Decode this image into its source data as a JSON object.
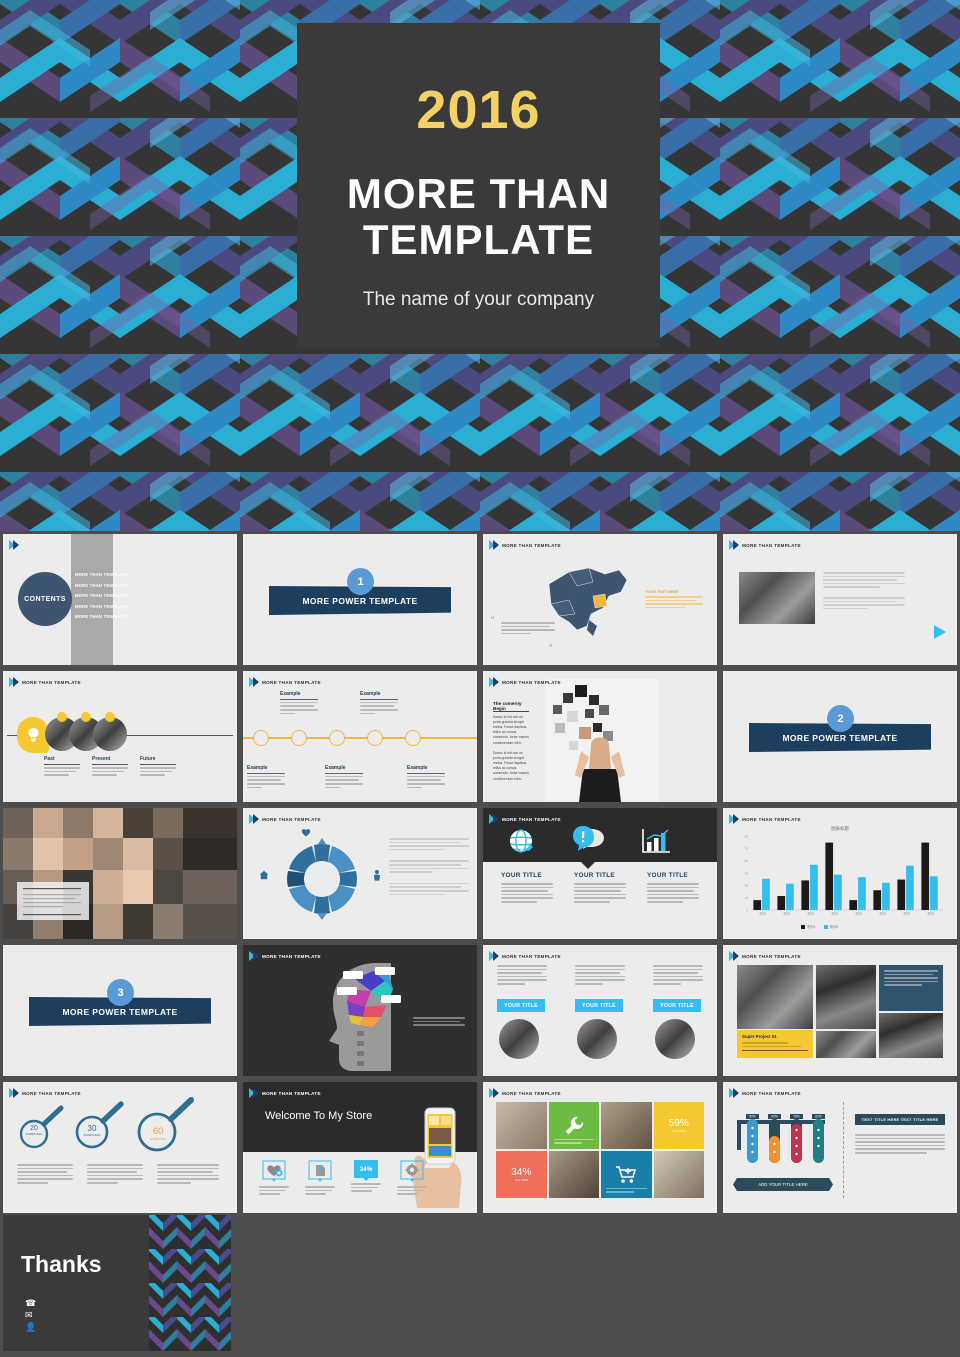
{
  "hero": {
    "year": "2016",
    "title_line1": "MORE THAN",
    "title_line2": "TEMPLATE",
    "subtitle": "The name of your company",
    "bg_color": "#353535",
    "accent_color": "#f5d163"
  },
  "common": {
    "header_label": "MORE THAN TEMPLATE",
    "chevron_light": "#3fb6ea",
    "chevron_dark": "#1f3f63",
    "navy": "#1d3f5f",
    "light_blue": "#5b9bd5",
    "cyan": "#35bdf2",
    "yellow": "#f5c731"
  },
  "slides": [
    {
      "id": "contents",
      "kind": "contents",
      "circle_label": "CONTENTS",
      "items": [
        "MORE THAN TEMPLATE",
        "MORE THAN TEMPLATE",
        "MORE THAN TEMPLATE",
        "MORE THAN TEMPLATE",
        "MORE THAN TEMPLATE"
      ]
    },
    {
      "id": "section-1",
      "kind": "section",
      "number": "1",
      "banner": "MORE POWER TEMPLATE"
    },
    {
      "id": "china-map",
      "kind": "map",
      "header": "MORE THAN TEMPLATE",
      "callout_title": "YOUR TEXT HERE",
      "quote_open": "“",
      "quote_close": "”"
    },
    {
      "id": "laptop-text",
      "kind": "image-text",
      "header": "MORE THAN TEMPLATE"
    },
    {
      "id": "past-present-future",
      "kind": "timeline-ppf",
      "header": "MORE THAN TEMPLATE",
      "steps": [
        "Past",
        "Present",
        "Future"
      ]
    },
    {
      "id": "example-timeline",
      "kind": "timeline-example",
      "header": "MORE THAN TEMPLATE",
      "labels": [
        "Example",
        "Example",
        "Example",
        "Example",
        "Example"
      ]
    },
    {
      "id": "company-begin",
      "kind": "text-photo",
      "header": "MORE THAN TEMPLATE",
      "title": "The comerny Begin",
      "body": "Donec id elit non mi porta gravida at eget metus. Fusce dapibus, tellus ac cursus commodo, tortor mauris condimentum nibh."
    },
    {
      "id": "section-2",
      "kind": "section",
      "number": "2",
      "banner": "MORE POWER TEMPLATE"
    },
    {
      "id": "team-photo",
      "kind": "full-photo"
    },
    {
      "id": "donut-diagram",
      "kind": "donut",
      "header": "MORE THAN TEMPLATE"
    },
    {
      "id": "three-icon-cards",
      "kind": "icon-cards",
      "header": "MORE THAN TEMPLATE",
      "cards": [
        {
          "title": "YOUR TITLE",
          "icon": "globe-icon"
        },
        {
          "title": "YOUR TITLE",
          "icon": "speech-bubble-icon"
        },
        {
          "title": "YOUR TITLE",
          "icon": "bar-chart-icon"
        }
      ],
      "body": "Add your text here and write down your ideas here add your text here and write down your ideas here add your text thank you"
    },
    {
      "id": "bar-chart",
      "kind": "chart",
      "header": "MORE THAN TEMPLATE"
    },
    {
      "id": "section-3",
      "kind": "section",
      "number": "3",
      "banner": "MORE POWER TEMPLATE"
    },
    {
      "id": "brain-head",
      "kind": "brain",
      "header": "MORE THAN TEMPLATE",
      "tags": [
        "TEXT",
        "TEXT",
        "TEXT",
        "TEXT"
      ],
      "body": "Add your text here and write down your ideas here add your text here"
    },
    {
      "id": "three-title-photos",
      "kind": "title-photos",
      "header": "MORE THAN TEMPLATE",
      "titles": [
        "YOUR TITLE",
        "YOUR TITLE",
        "YOUR TITLE"
      ]
    },
    {
      "id": "architecture-mosaic",
      "kind": "mosaic-arch",
      "header": "MORE THAN TEMPLATE",
      "project_label": "Super Project 01"
    },
    {
      "id": "magnifier-stats",
      "kind": "magnifiers",
      "header": "MORE THAN TEMPLATE",
      "stats": [
        {
          "value": "20",
          "label": "SOMETHING",
          "color": "#2f6f8f"
        },
        {
          "value": "30",
          "label": "SOMETHING",
          "color": "#2f6f8f"
        },
        {
          "value": "60",
          "label": "SOMETHING",
          "color": "#e8a33d"
        }
      ]
    },
    {
      "id": "welcome-store",
      "kind": "store",
      "header": "MORE THAN TEMPLATE",
      "title": "Welcome To My Store",
      "tiles": [
        {
          "icon": "heart-icon",
          "label": ""
        },
        {
          "icon": "document-icon",
          "label": ""
        },
        {
          "icon": "percent-badge",
          "label": "34%"
        },
        {
          "icon": "gear-icon",
          "label": ""
        }
      ]
    },
    {
      "id": "color-mosaic",
      "kind": "mosaic-color",
      "header": "MORE THAN TEMPLATE",
      "stats": [
        {
          "value": "59%",
          "sub": "Your 2015",
          "color": "#f5c731"
        },
        {
          "value": "34%",
          "sub": "Your 2016",
          "color": "#ef6f5b"
        }
      ],
      "tile_colors": [
        "#6cbb45",
        "#1a7fa8"
      ]
    },
    {
      "id": "test-tubes",
      "kind": "tubes",
      "header": "MORE THAN TEMPLATE",
      "percents": [
        "50%",
        "42%",
        "75%",
        "62%"
      ],
      "title_badge": "TEXT TITLE HERE  TEXT TITLE HERE",
      "ribbon": "ADD YOUR TITLE HERE",
      "body": "Add your text here and write down your ideas here add your text here and write down your ideas here add your text. Thank you , add your text here and write down your ideas here add your text here and write down your ideas here add your text. Thank you ."
    }
  ],
  "thanks": {
    "title": "Thanks",
    "icons": [
      "phone-icon",
      "email-icon",
      "person-icon"
    ]
  },
  "chart_data": {
    "type": "bar",
    "title": "图表标题",
    "categories": [
      "类别1",
      "类别2",
      "类别3",
      "类别4",
      "类别5",
      "类别6",
      "类别7",
      "类别8"
    ],
    "series": [
      {
        "name": "系列1",
        "color": "#1a1a1a",
        "values": [
          12,
          17,
          36,
          82,
          12,
          24,
          37,
          82
        ]
      },
      {
        "name": "系列2",
        "color": "#35bdf2",
        "values": [
          38,
          32,
          55,
          43,
          40,
          33,
          54,
          41
        ]
      }
    ],
    "ylim": [
      0,
      90
    ],
    "yticks": [
      "0",
      "15",
      "30",
      "45",
      "60",
      "75",
      "90"
    ],
    "legend_position": "bottom",
    "grid": false
  }
}
